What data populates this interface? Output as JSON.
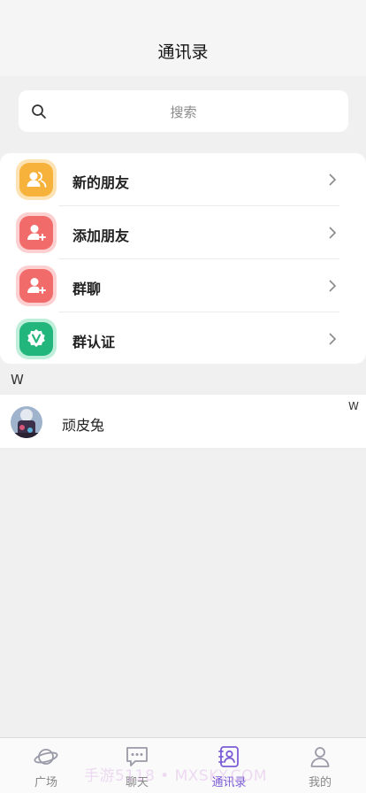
{
  "header": {
    "title": "通讯录"
  },
  "search": {
    "placeholder": "搜索",
    "icon": "search-icon"
  },
  "menu": [
    {
      "label": "新的朋友",
      "icon": "new-friends-icon",
      "color": "#f7b23b"
    },
    {
      "label": "添加朋友",
      "icon": "add-friend-icon",
      "color": "#f26b6b"
    },
    {
      "label": "群聊",
      "icon": "group-chat-icon",
      "color": "#f26b6b"
    },
    {
      "label": "群认证",
      "icon": "group-verify-icon",
      "color": "#23b67c"
    }
  ],
  "contacts": {
    "section_letter": "W",
    "index_letter": "W",
    "items": [
      {
        "name": "顽皮兔",
        "avatar": "avatar"
      }
    ]
  },
  "tabbar": {
    "active_color": "#7b5cd6",
    "items": [
      {
        "label": "广场",
        "icon": "planet-icon",
        "active": false
      },
      {
        "label": "聊天",
        "icon": "chat-bubble-icon",
        "active": false
      },
      {
        "label": "通讯录",
        "icon": "contacts-book-icon",
        "active": true
      },
      {
        "label": "我的",
        "icon": "profile-icon",
        "active": false
      }
    ]
  },
  "watermark": "手游5118 • MXSKY.COM"
}
